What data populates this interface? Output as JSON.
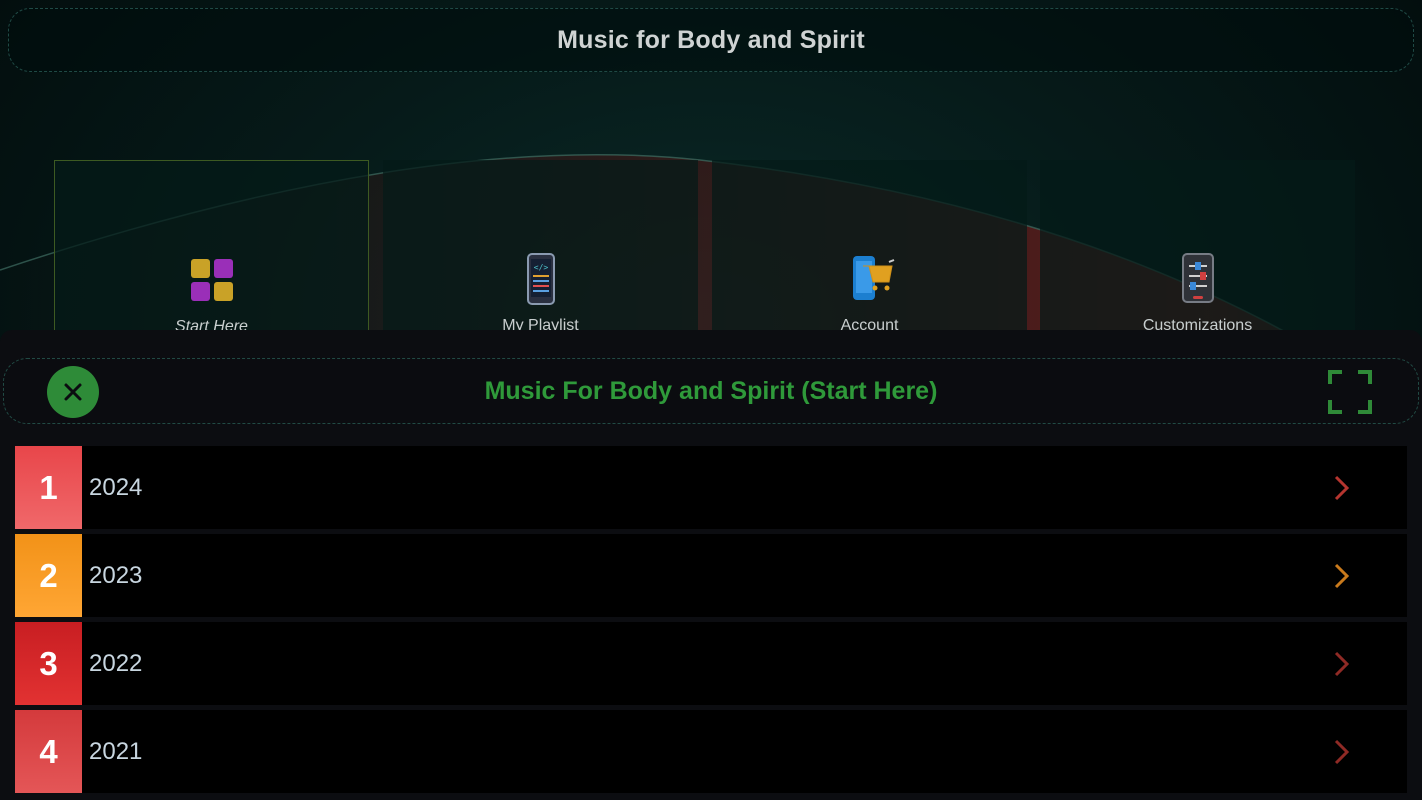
{
  "app": {
    "title": "Music for Body and Spirit"
  },
  "tiles": [
    {
      "label": "Start Here",
      "icon": "grid-apps-icon",
      "active": true
    },
    {
      "label": "My Playlist",
      "icon": "phone-playlist-icon",
      "active": false
    },
    {
      "label": "Account",
      "icon": "cart-phone-icon",
      "active": false
    },
    {
      "label": "Customizations",
      "icon": "sliders-icon",
      "active": false
    }
  ],
  "sheet": {
    "title": "Music For Body and Spirit (Start Here)",
    "close_icon": "close-icon",
    "expand_icon": "fullscreen-icon"
  },
  "rows": [
    {
      "number": "1",
      "label": "2024",
      "badge_color": "#e8464a",
      "badge_color2": "#f0686a",
      "chevron_color": "#b5352f"
    },
    {
      "number": "2",
      "label": "2023",
      "badge_color": "#f29218",
      "badge_color2": "#ffa634",
      "chevron_color": "#c97a1c"
    },
    {
      "number": "3",
      "label": "2022",
      "badge_color": "#c81e22",
      "badge_color2": "#e23232",
      "chevron_color": "#8f2a25"
    },
    {
      "number": "4",
      "label": "2021",
      "badge_color": "#d43a3c",
      "badge_color2": "#e45657",
      "chevron_color": "#8f2a25"
    }
  ],
  "colors": {
    "accent": "#2f9a3a",
    "background": "#061a19"
  }
}
